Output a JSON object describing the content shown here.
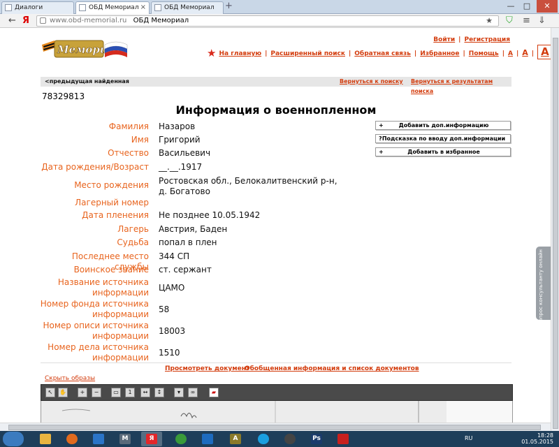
{
  "browser": {
    "tabs": [
      {
        "label": "Диалоги",
        "active": false
      },
      {
        "label": "ОБД Мемориал",
        "active": true
      },
      {
        "label": "ОБД Мемориал",
        "active": false
      }
    ],
    "url_domain": "www.obd-memorial.ru",
    "url_title": "ОБД Мемориал",
    "new_tab": "+",
    "back": "←",
    "home": "Я",
    "minimize": "—",
    "maximize": "□",
    "close": "✕"
  },
  "site": {
    "logo_text": "Мемориал",
    "auth": {
      "login": "Войти",
      "register": "Регистрация"
    },
    "nav": [
      "На главную",
      "Расширенный поиск",
      "Обратная связь",
      "Избранное",
      "Помощь"
    ],
    "font_sizes": [
      "A",
      "A",
      "A"
    ]
  },
  "nav_bar": {
    "prev": "<предыдущая найденная",
    "back_to_search": "Вернуться к поиску",
    "back_to_results": "Вернуться к результатам поиска"
  },
  "record": {
    "id": "78329813",
    "title": "Информация о военнопленном",
    "fields": [
      {
        "label": "Фамилия",
        "value": "Назаров"
      },
      {
        "label": "Имя",
        "value": "Григорий"
      },
      {
        "label": "Отчество",
        "value": "Васильевич"
      },
      {
        "label": "Дата рождения/Возраст",
        "value": "__.__.1917"
      },
      {
        "label": "Место рождения",
        "value": "Ростовская обл., Белокалитвенский р-н, д. Богатово"
      },
      {
        "label": "Лагерный номер",
        "value": ""
      },
      {
        "label": "Дата пленения",
        "value": "Не позднее 10.05.1942"
      },
      {
        "label": "Лагерь",
        "value": "Австрия, Баден"
      },
      {
        "label": "Судьба",
        "value": "попал в плен"
      },
      {
        "label": "Последнее место службы",
        "value": "344 СП"
      },
      {
        "label": "Воинское звание",
        "value": "ст. сержант"
      },
      {
        "label": "Название источника информации",
        "value": "ЦАМО"
      },
      {
        "label": "Номер фонда источника информации",
        "value": "58"
      },
      {
        "label": "Номер описи источника информации",
        "value": "18003"
      },
      {
        "label": "Номер дела источника информации",
        "value": "1510"
      }
    ]
  },
  "actions": [
    {
      "symbol": "+",
      "label": "Добавить доп.информацию"
    },
    {
      "symbol": "?",
      "label": "Подсказка по вводу доп.информации"
    },
    {
      "symbol": "+",
      "label": "Добавить в избранное"
    }
  ],
  "bottom": {
    "view_doc": "Просмотреть документ",
    "summary": "Обобщенная информация и список документов",
    "hide_images": "Скрыть образы"
  },
  "side_widget": "Задать вопрос консультанту онлайн",
  "taskbar": {
    "lang": "RU",
    "time": "18:28",
    "date": "01.05.2015",
    "apps": [
      "",
      "",
      "",
      "M",
      "Я",
      "",
      "",
      "A",
      "",
      "",
      "Ps",
      ""
    ]
  },
  "colors": {
    "accent": "#d33c0d",
    "label": "#e8641e",
    "star": "#d92b1d"
  }
}
